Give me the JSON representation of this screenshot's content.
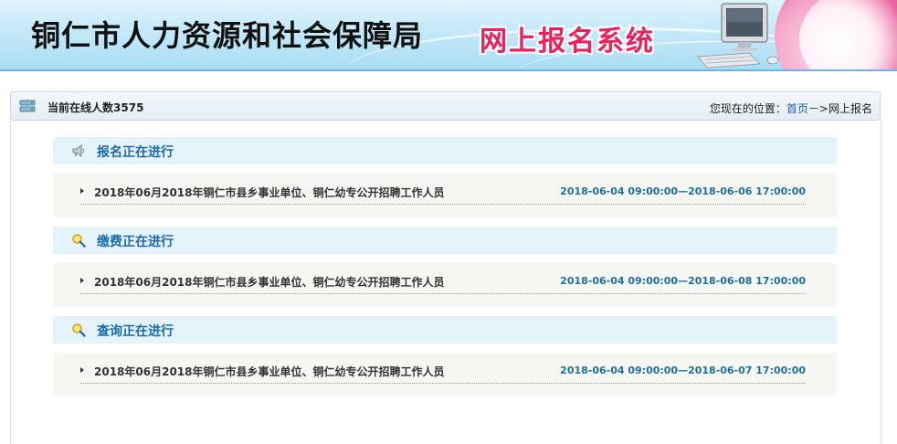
{
  "banner": {
    "title": "铜仁市人力资源和社会保障局",
    "system_name": "网上报名系统"
  },
  "location_bar": {
    "online_label": "当前在线人数",
    "online_count": "3575",
    "location_prefix": "您现在的位置：",
    "home_link": "首页",
    "separator": "－>",
    "current": "网上报名"
  },
  "sections": [
    {
      "title": "报名正在进行",
      "icon": "megaphone-icon",
      "items": [
        {
          "title": "2018年06月2018年铜仁市县乡事业单位、铜仁幼专公开招聘工作人员",
          "time": "2018-06-04 09:00:00—2018-06-06 17:00:00"
        }
      ]
    },
    {
      "title": "缴费正在进行",
      "icon": "magnifier-icon",
      "items": [
        {
          "title": "2018年06月2018年铜仁市县乡事业单位、铜仁幼专公开招聘工作人员",
          "time": "2018-06-04 09:00:00—2018-06-08 17:00:00"
        }
      ]
    },
    {
      "title": "查询正在进行",
      "icon": "magnifier-icon",
      "items": [
        {
          "title": "2018年06月2018年铜仁市县乡事业单位、铜仁幼专公开招聘工作人员",
          "time": "2018-06-04 09:00:00—2018-06-07 17:00:00"
        }
      ]
    }
  ],
  "colors": {
    "accent_blue": "#1b6aa8",
    "time_blue": "#1f6f9a",
    "system_pink": "#e8225c",
    "header_bg": "#e5f3fb",
    "row_bg": "#f6f6f2"
  }
}
